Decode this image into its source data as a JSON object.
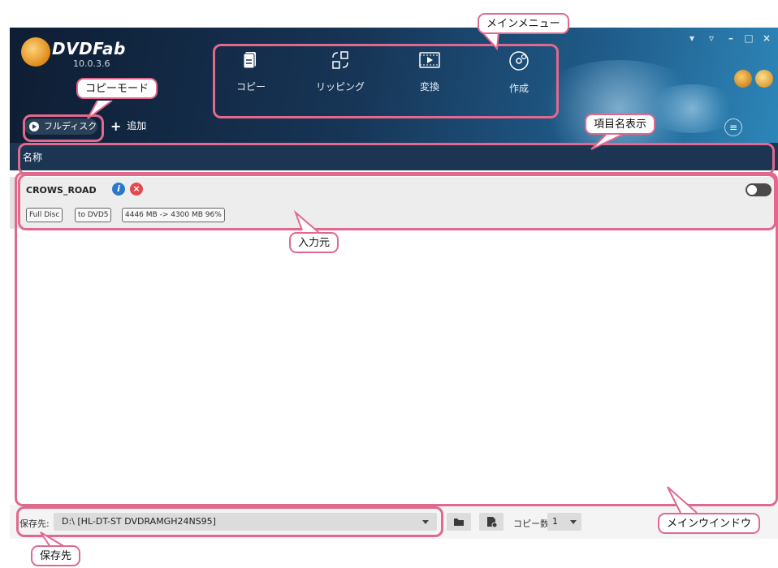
{
  "app": {
    "brand": "DVDFab",
    "version": "10.0.3.6",
    "window_controls": [
      "▾",
      "▿",
      "–",
      "□",
      "×"
    ]
  },
  "main_menu": [
    {
      "label": "コピー",
      "icon": "copy-icon"
    },
    {
      "label": "リッピング",
      "icon": "ripping-icon"
    },
    {
      "label": "変換",
      "icon": "convert-icon"
    },
    {
      "label": "作成",
      "icon": "create-disc-icon"
    }
  ],
  "toolbar": {
    "copy_mode_label": "フルディスク",
    "add_label": "追加"
  },
  "column_header": {
    "name": "名称"
  },
  "source": {
    "title": "CROWS_ROAD",
    "tags": [
      "Full Disc",
      "to DVD5",
      "4446 MB -> 4300 MB 96%"
    ],
    "toggle_on": false
  },
  "bottom_bar": {
    "save_label": "保存先:",
    "save_value": "D:\\ [HL-DT-ST DVDRAMGH24NS95]",
    "copies_label": "コピー数:",
    "copies_value": "1"
  },
  "annotations": {
    "main_menu": "メインメニュー",
    "copy_mode": "コピーモード",
    "column_header": "項目名表示",
    "source": "入力元",
    "main_window": "メインウインドウ",
    "save_destination": "保存先"
  },
  "colors": {
    "highlight": "#e1698d",
    "header_dark": "#1b3552",
    "info": "#2b78c9",
    "delete": "#e5484d"
  }
}
